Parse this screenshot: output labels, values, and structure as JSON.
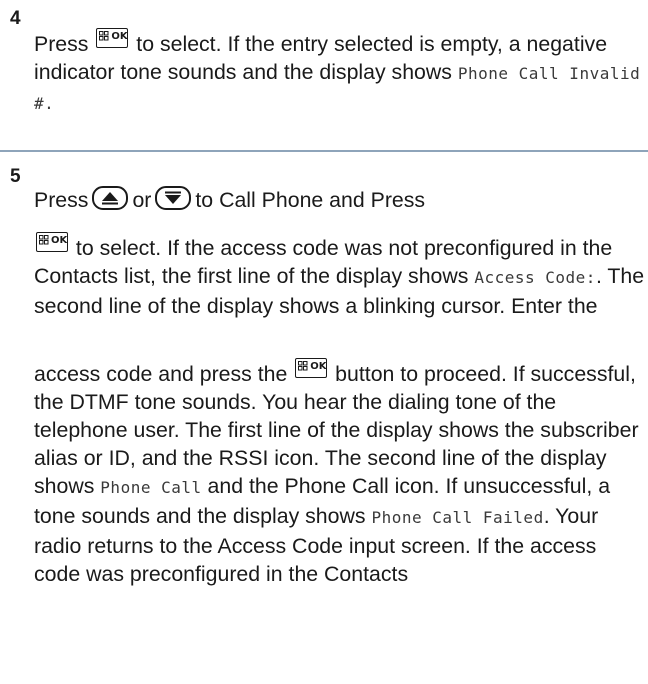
{
  "steps": [
    {
      "number": "4",
      "text": {
        "press": "Press",
        "after_key": " to select. If the entry selected is empty, a negative indicator tone sounds and the display shows ",
        "display_msg": "Phone Call Invalid #.",
        "end": ""
      }
    },
    {
      "number": "5",
      "line1": {
        "press": "Press",
        "or": "or",
        "rest": "to Call Phone and Press"
      },
      "para2": {
        "after_key": " to select. If the access code was not preconfigured in the Contacts list, the first line of the display shows ",
        "access_code": "Access Code:",
        "after_access": ". The second line of the display shows a blinking cursor. Enter the"
      },
      "para3": {
        "before_key": "access code and press the ",
        "after_key": " button to proceed. If successful, the DTMF tone sounds. You hear the dialing tone of the telephone user. The first line of the display shows the subscriber alias or ID, and the RSSI icon. The second line of the display shows ",
        "phone_call": "Phone Call",
        "after_phone_call": " and the Phone Call icon. If unsuccessful, a tone sounds and the display shows ",
        "phone_call_failed": "Phone Call Failed",
        "end": ". Your radio returns to the Access Code input screen. If the access code was preconfigured in the Contacts"
      }
    }
  ],
  "icons": {
    "menu_ok_label": "OK",
    "menu_ok_icon": "menu-ok-key-icon",
    "up_icon": "up-arrow-key-icon",
    "down_icon": "down-arrow-key-icon"
  },
  "colors": {
    "divider": "#8ea4ba",
    "text": "#1a1a1a",
    "display_text": "#3a3a3a"
  }
}
